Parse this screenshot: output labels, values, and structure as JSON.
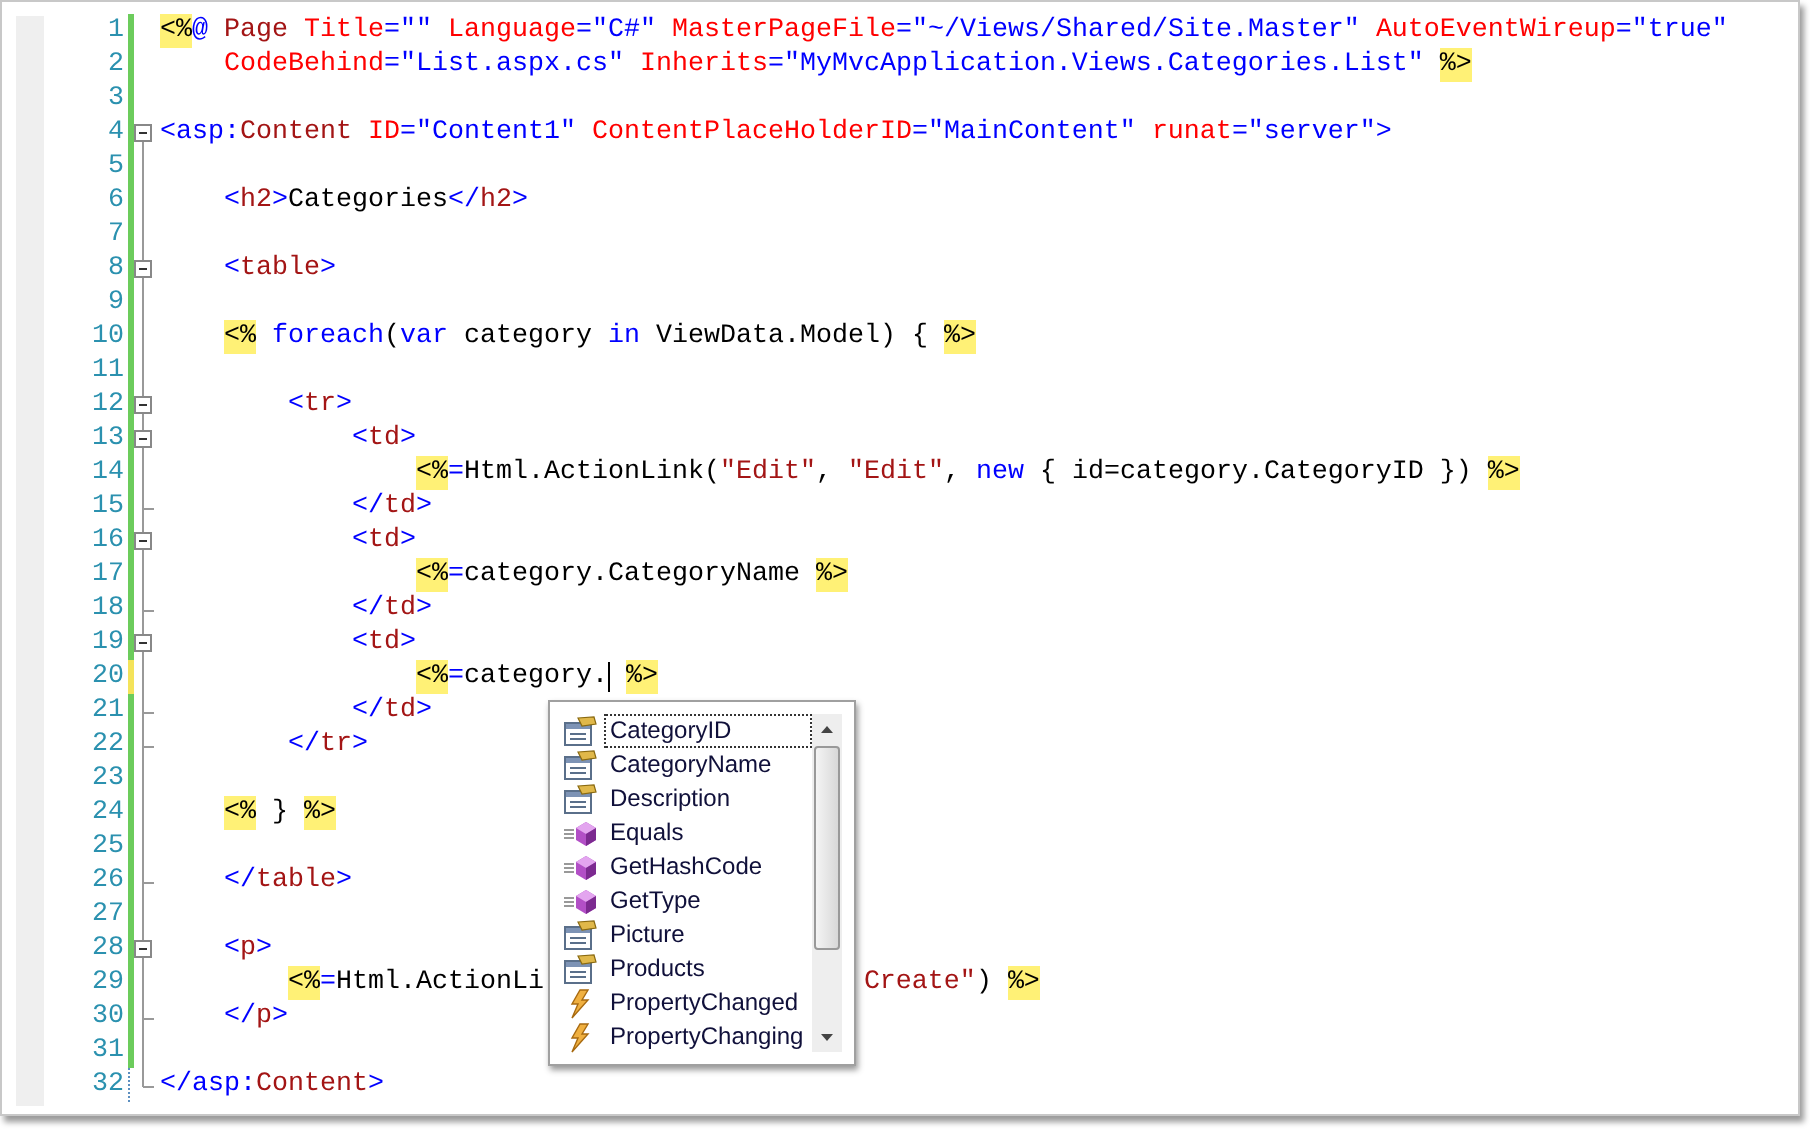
{
  "editor": {
    "lines": [
      {
        "number": "1",
        "tracked": true,
        "unsaved": false,
        "in_block": false,
        "collapsible": false,
        "block_end": false,
        "tokens": [
          {
            "kind": "delim",
            "text": "<%"
          },
          {
            "kind": "blue",
            "text": "@ "
          },
          {
            "kind": "tag",
            "text": "Page "
          },
          {
            "kind": "attr",
            "text": "Title"
          },
          {
            "kind": "blue",
            "text": "=\"\" "
          },
          {
            "kind": "attr",
            "text": "Language"
          },
          {
            "kind": "blue",
            "text": "=\"C#\" "
          },
          {
            "kind": "attr",
            "text": "MasterPageFile"
          },
          {
            "kind": "blue",
            "text": "=\"~/Views/Shared/Site.Master\" "
          },
          {
            "kind": "attr",
            "text": "AutoEventWireup"
          },
          {
            "kind": "blue",
            "text": "=\"true\""
          }
        ]
      },
      {
        "number": "2",
        "tracked": true,
        "unsaved": false,
        "in_block": false,
        "collapsible": false,
        "block_end": false,
        "tokens": [
          {
            "kind": "attr",
            "text": "    CodeBehind"
          },
          {
            "kind": "blue",
            "text": "=\"List.aspx.cs\" "
          },
          {
            "kind": "attr",
            "text": "Inherits"
          },
          {
            "kind": "blue",
            "text": "=\"MyMvcApplication.Views.Categories.List\" "
          },
          {
            "kind": "delim",
            "text": "%>"
          }
        ]
      },
      {
        "number": "3",
        "tracked": true,
        "unsaved": false,
        "in_block": false,
        "collapsible": false,
        "block_end": false
      },
      {
        "number": "4",
        "tracked": true,
        "unsaved": false,
        "in_block": true,
        "collapsible": true,
        "block_end": false,
        "tokens": [
          {
            "kind": "blue",
            "text": "<asp:"
          },
          {
            "kind": "tag",
            "text": "Content "
          },
          {
            "kind": "attr",
            "text": "ID"
          },
          {
            "kind": "blue",
            "text": "=\"Content1\" "
          },
          {
            "kind": "attr",
            "text": "ContentPlaceHolderID"
          },
          {
            "kind": "blue",
            "text": "=\"MainContent\" "
          },
          {
            "kind": "attr",
            "text": "runat"
          },
          {
            "kind": "blue",
            "text": "=\"server\">"
          }
        ]
      },
      {
        "number": "5",
        "tracked": true,
        "unsaved": false,
        "in_block": true,
        "collapsible": false,
        "block_end": false
      },
      {
        "number": "6",
        "tracked": true,
        "unsaved": false,
        "in_block": true,
        "collapsible": false,
        "block_end": false,
        "tokens": [
          {
            "kind": "blue",
            "text": "    <"
          },
          {
            "kind": "tag",
            "text": "h2"
          },
          {
            "kind": "blue",
            "text": ">"
          },
          {
            "kind": "plain",
            "text": "Categories"
          },
          {
            "kind": "blue",
            "text": "</"
          },
          {
            "kind": "tag",
            "text": "h2"
          },
          {
            "kind": "blue",
            "text": ">"
          }
        ]
      },
      {
        "number": "7",
        "tracked": true,
        "unsaved": false,
        "in_block": true,
        "collapsible": false,
        "block_end": false
      },
      {
        "number": "8",
        "tracked": true,
        "unsaved": false,
        "in_block": true,
        "collapsible": true,
        "block_end": false,
        "tokens": [
          {
            "kind": "blue",
            "text": "    <"
          },
          {
            "kind": "tag",
            "text": "table"
          },
          {
            "kind": "blue",
            "text": ">"
          }
        ]
      },
      {
        "number": "9",
        "tracked": true,
        "unsaved": false,
        "in_block": true,
        "collapsible": false,
        "block_end": false
      },
      {
        "number": "10",
        "tracked": true,
        "unsaved": false,
        "in_block": true,
        "collapsible": false,
        "block_end": false,
        "tokens": [
          {
            "kind": "delim",
            "text": "    <%"
          },
          {
            "kind": "blue",
            "text": " foreach"
          },
          {
            "kind": "plain",
            "text": "("
          },
          {
            "kind": "blue",
            "text": "var"
          },
          {
            "kind": "plain",
            "text": " category "
          },
          {
            "kind": "blue",
            "text": "in"
          },
          {
            "kind": "plain",
            "text": " ViewData.Model) { "
          },
          {
            "kind": "delim",
            "text": "%>"
          }
        ]
      },
      {
        "number": "11",
        "tracked": true,
        "unsaved": false,
        "in_block": true,
        "collapsible": false,
        "block_end": false
      },
      {
        "number": "12",
        "tracked": true,
        "unsaved": false,
        "in_block": true,
        "collapsible": true,
        "block_end": false,
        "tokens": [
          {
            "kind": "blue",
            "text": "        <"
          },
          {
            "kind": "tag",
            "text": "tr"
          },
          {
            "kind": "blue",
            "text": ">"
          }
        ]
      },
      {
        "number": "13",
        "tracked": true,
        "unsaved": false,
        "in_block": true,
        "collapsible": true,
        "block_end": false,
        "tokens": [
          {
            "kind": "blue",
            "text": "            <"
          },
          {
            "kind": "tag",
            "text": "td"
          },
          {
            "kind": "blue",
            "text": ">"
          }
        ]
      },
      {
        "number": "14",
        "tracked": true,
        "unsaved": false,
        "in_block": true,
        "collapsible": false,
        "block_end": false,
        "tokens": [
          {
            "kind": "delim",
            "text": "                <%"
          },
          {
            "kind": "blue",
            "text": "="
          },
          {
            "kind": "plain",
            "text": "Html.ActionLink("
          },
          {
            "kind": "string",
            "text": "\"Edit\""
          },
          {
            "kind": "plain",
            "text": ", "
          },
          {
            "kind": "string",
            "text": "\"Edit\""
          },
          {
            "kind": "plain",
            "text": ", "
          },
          {
            "kind": "blue",
            "text": "new"
          },
          {
            "kind": "plain",
            "text": " { id=category.CategoryID }) "
          },
          {
            "kind": "delim",
            "text": "%>"
          }
        ]
      },
      {
        "number": "15",
        "tracked": true,
        "unsaved": false,
        "in_block": true,
        "collapsible": false,
        "block_end": true,
        "tokens": [
          {
            "kind": "blue",
            "text": "            </"
          },
          {
            "kind": "tag",
            "text": "td"
          },
          {
            "kind": "blue",
            "text": ">"
          }
        ]
      },
      {
        "number": "16",
        "tracked": true,
        "unsaved": false,
        "in_block": true,
        "collapsible": true,
        "block_end": false,
        "tokens": [
          {
            "kind": "blue",
            "text": "            <"
          },
          {
            "kind": "tag",
            "text": "td"
          },
          {
            "kind": "blue",
            "text": ">"
          }
        ]
      },
      {
        "number": "17",
        "tracked": true,
        "unsaved": false,
        "in_block": true,
        "collapsible": false,
        "block_end": false,
        "tokens": [
          {
            "kind": "delim",
            "text": "                <%"
          },
          {
            "kind": "blue",
            "text": "="
          },
          {
            "kind": "plain",
            "text": "category.CategoryName "
          },
          {
            "kind": "delim",
            "text": "%>"
          }
        ]
      },
      {
        "number": "18",
        "tracked": true,
        "unsaved": false,
        "in_block": true,
        "collapsible": false,
        "block_end": true,
        "tokens": [
          {
            "kind": "blue",
            "text": "            </"
          },
          {
            "kind": "tag",
            "text": "td"
          },
          {
            "kind": "blue",
            "text": ">"
          }
        ]
      },
      {
        "number": "19",
        "tracked": true,
        "unsaved": false,
        "in_block": true,
        "collapsible": true,
        "block_end": false,
        "tokens": [
          {
            "kind": "blue",
            "text": "            <"
          },
          {
            "kind": "tag",
            "text": "td"
          },
          {
            "kind": "blue",
            "text": ">"
          }
        ]
      },
      {
        "number": "20",
        "tracked": true,
        "unsaved": true,
        "in_block": true,
        "collapsible": false,
        "block_end": false,
        "tokens": [
          {
            "kind": "delim",
            "text": "                <%"
          },
          {
            "kind": "blue",
            "text": "="
          },
          {
            "kind": "plain",
            "text": "category.",
            "caret": true
          },
          {
            "kind": "delim",
            "text": " %>"
          }
        ]
      },
      {
        "number": "21",
        "tracked": true,
        "unsaved": false,
        "in_block": true,
        "collapsible": false,
        "block_end": true,
        "tokens": [
          {
            "kind": "blue",
            "text": "            </"
          },
          {
            "kind": "tag",
            "text": "td"
          },
          {
            "kind": "blue",
            "text": ">"
          }
        ]
      },
      {
        "number": "22",
        "tracked": true,
        "unsaved": false,
        "in_block": true,
        "collapsible": false,
        "block_end": true,
        "tokens": [
          {
            "kind": "blue",
            "text": "        </"
          },
          {
            "kind": "tag",
            "text": "tr"
          },
          {
            "kind": "blue",
            "text": ">"
          }
        ]
      },
      {
        "number": "23",
        "tracked": true,
        "unsaved": false,
        "in_block": true,
        "collapsible": false,
        "block_end": false
      },
      {
        "number": "24",
        "tracked": true,
        "unsaved": false,
        "in_block": true,
        "collapsible": false,
        "block_end": false,
        "tokens": [
          {
            "kind": "delim",
            "text": "    <%"
          },
          {
            "kind": "plain",
            "text": " } "
          },
          {
            "kind": "delim",
            "text": "%>"
          }
        ]
      },
      {
        "number": "25",
        "tracked": true,
        "unsaved": false,
        "in_block": true,
        "collapsible": false,
        "block_end": false
      },
      {
        "number": "26",
        "tracked": true,
        "unsaved": false,
        "in_block": true,
        "collapsible": false,
        "block_end": true,
        "tokens": [
          {
            "kind": "blue",
            "text": "    </"
          },
          {
            "kind": "tag",
            "text": "table"
          },
          {
            "kind": "blue",
            "text": ">"
          }
        ]
      },
      {
        "number": "27",
        "tracked": true,
        "unsaved": false,
        "in_block": true,
        "collapsible": false,
        "block_end": false
      },
      {
        "number": "28",
        "tracked": true,
        "unsaved": false,
        "in_block": true,
        "collapsible": true,
        "block_end": false,
        "tokens": [
          {
            "kind": "blue",
            "text": "    <"
          },
          {
            "kind": "tag",
            "text": "p"
          },
          {
            "kind": "blue",
            "text": ">"
          }
        ]
      },
      {
        "number": "29",
        "tracked": true,
        "unsaved": false,
        "in_block": true,
        "collapsible": false,
        "block_end": false,
        "tokens": [
          {
            "kind": "delim",
            "text": "        <%"
          },
          {
            "kind": "blue",
            "text": "="
          },
          {
            "kind": "plain",
            "text": "Html.ActionLi"
          },
          {
            "kind": "string",
            "text": "Create\"",
            "after_gap": true
          },
          {
            "kind": "plain",
            "text": ") "
          },
          {
            "kind": "delim",
            "text": "%>"
          }
        ]
      },
      {
        "number": "30",
        "tracked": true,
        "unsaved": false,
        "in_block": true,
        "collapsible": false,
        "block_end": true,
        "tokens": [
          {
            "kind": "blue",
            "text": "    </"
          },
          {
            "kind": "tag",
            "text": "p"
          },
          {
            "kind": "blue",
            "text": ">"
          }
        ]
      },
      {
        "number": "31",
        "tracked": true,
        "unsaved": false,
        "in_block": true,
        "collapsible": false,
        "block_end": false
      },
      {
        "number": "32",
        "tracked": false,
        "unsaved": false,
        "in_block": true,
        "collapsible": false,
        "block_end": true,
        "tokens": [
          {
            "kind": "blue",
            "text": "</asp:"
          },
          {
            "kind": "tag",
            "text": "Content"
          },
          {
            "kind": "blue",
            "text": ">"
          }
        ]
      }
    ]
  },
  "completion": {
    "items": [
      {
        "label": "CategoryID",
        "kind": "property",
        "selected": true
      },
      {
        "label": "CategoryName",
        "kind": "property",
        "selected": false
      },
      {
        "label": "Description",
        "kind": "property",
        "selected": false
      },
      {
        "label": "Equals",
        "kind": "method",
        "selected": false
      },
      {
        "label": "GetHashCode",
        "kind": "method",
        "selected": false
      },
      {
        "label": "GetType",
        "kind": "method",
        "selected": false
      },
      {
        "label": "Picture",
        "kind": "property",
        "selected": false
      },
      {
        "label": "Products",
        "kind": "property",
        "selected": false
      },
      {
        "label": "PropertyChanged",
        "kind": "event",
        "selected": false
      },
      {
        "label": "PropertyChanging",
        "kind": "event",
        "selected": false
      }
    ]
  }
}
